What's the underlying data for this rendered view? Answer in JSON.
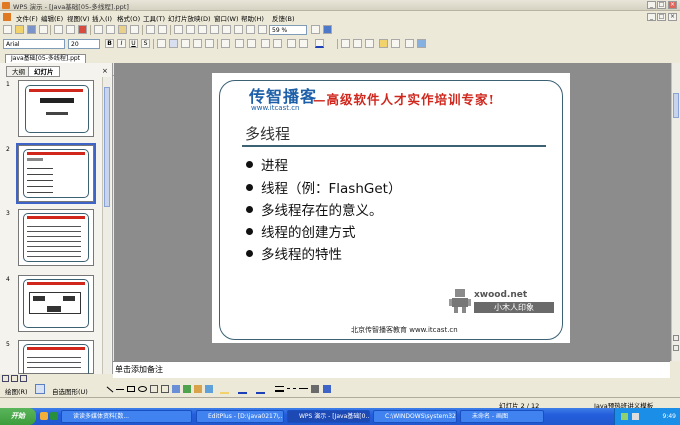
{
  "window": {
    "title": "WPS 演示 - [Java基础[05-多线程].ppt]"
  },
  "menu": [
    "文件(F)",
    "编辑(E)",
    "视图(V)",
    "插入(I)",
    "格式(O)",
    "工具(T)",
    "幻灯片放映(D)",
    "窗口(W)",
    "帮助(H)",
    "反馈(B)"
  ],
  "toolbar": {
    "zoom": "59 %",
    "font": "Arial",
    "size": "20"
  },
  "tabs": {
    "outline": "大纲",
    "slides": "幻灯片",
    "doc": "Java基础[05-多线程].ppt"
  },
  "thumbs": [
    {
      "num": "1"
    },
    {
      "num": "2"
    },
    {
      "num": "3"
    },
    {
      "num": "4"
    },
    {
      "num": "5"
    }
  ],
  "slide": {
    "logo_name": "传智播客",
    "logo_url": "www.itcast.cn",
    "slogan": "—高级软件人才实作培训专家!",
    "title": "多线程",
    "bullets": [
      "进程",
      "线程（例：FlashGet）",
      "多线程存在的意义。",
      "线程的创建方式",
      "多线程的特性"
    ],
    "footer": "北京传智播客教育 www.itcast.cn",
    "watermark_top": "xwood.net",
    "watermark_bottom": "小木人印象"
  },
  "notes": {
    "placeholder": "单击添加备注"
  },
  "drawbar": {
    "draw": "绘图(R)",
    "autoshape": "自选图形(U)"
  },
  "status": {
    "slide": "幻灯片 2 / 12",
    "template": "Java预热班讲义模板"
  },
  "taskbar": {
    "start": "开始",
    "tasks": [
      "读读多媒体资料[数...",
      "EditPlus - [D:\\java0217\\...",
      "WPS 演示 - [Java基础[0...",
      "C:\\WINDOWS\\system32...",
      "未命名 - 画图"
    ],
    "time": "9:49"
  },
  "colors": {
    "brand_red": "#d0261c",
    "brand_blue": "#1d5fa8",
    "frame": "#3b6173",
    "selection": "#3d64c6"
  }
}
